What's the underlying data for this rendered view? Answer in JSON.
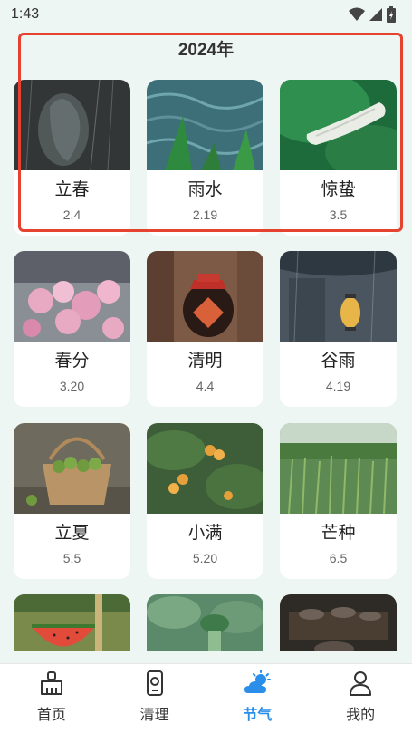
{
  "status_bar": {
    "time": "1:43"
  },
  "header": {
    "year_title": "2024年"
  },
  "terms": [
    {
      "name": "立春",
      "date": "2.4"
    },
    {
      "name": "雨水",
      "date": "2.19"
    },
    {
      "name": "惊蛰",
      "date": "3.5"
    },
    {
      "name": "春分",
      "date": "3.20"
    },
    {
      "name": "清明",
      "date": "4.4"
    },
    {
      "name": "谷雨",
      "date": "4.19"
    },
    {
      "name": "立夏",
      "date": "5.5"
    },
    {
      "name": "小满",
      "date": "5.20"
    },
    {
      "name": "芒种",
      "date": "6.5"
    }
  ],
  "tab_bar": {
    "active_color": "#2b8ee8",
    "items": [
      {
        "label": "首页",
        "icon": "broom-icon"
      },
      {
        "label": "清理",
        "icon": "phone-icon"
      },
      {
        "label": "节气",
        "icon": "weather-icon",
        "active": true
      },
      {
        "label": "我的",
        "icon": "user-icon"
      }
    ]
  },
  "highlight_color": "#e5432f"
}
